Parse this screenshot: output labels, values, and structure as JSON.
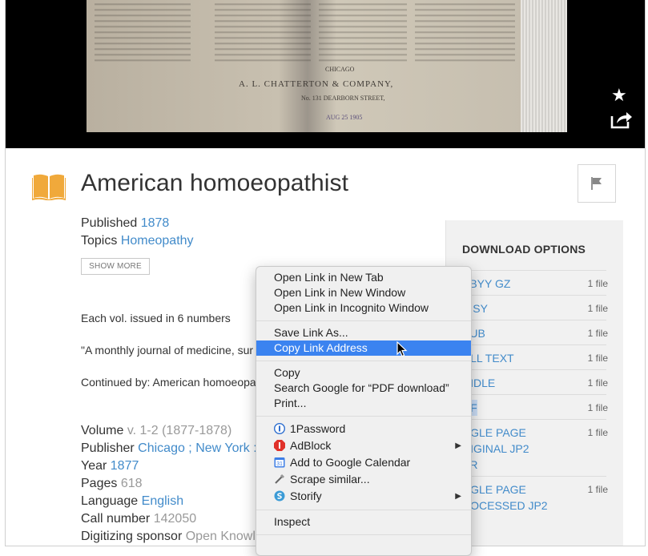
{
  "viewer": {
    "scan_lines": [
      "CHICAGO",
      "A. L. CHATTERTON & COMPANY,",
      "No. 131 DEARBORN STREET,",
      "AUG 25 1905"
    ],
    "star_icon": "star-icon",
    "share_icon": "share-icon"
  },
  "item": {
    "title": "American homoeopathist",
    "published_label": "Published",
    "published_value": "1878",
    "topics_label": "Topics",
    "topics_value": "Homeopathy",
    "show_more": "SHOW MORE",
    "desc1": "Each vol. issued in 6 numbers",
    "desc2": "\"A monthly journal of medicine, sur",
    "desc3": "Continued by: American homoeopa",
    "volume_label": "Volume",
    "volume_value": "v. 1-2 (1877-1878)",
    "publisher_label": "Publisher",
    "publisher_value": "Chicago ; New York : /",
    "year_label": "Year",
    "year_value": "1877",
    "pages_label": "Pages",
    "pages_value": "618",
    "language_label": "Language",
    "language_value": "English",
    "callnumber_label": "Call number",
    "callnumber_value": "142050",
    "sponsor_label": "Digitizing sponsor",
    "sponsor_value": "Open Knowle"
  },
  "download": {
    "title": "DOWNLOAD OPTIONS",
    "rows": [
      {
        "name": "BBYY GZ",
        "count": "1 file"
      },
      {
        "name": "AISY",
        "count": "1 file"
      },
      {
        "name": "PUB",
        "count": "1 file"
      },
      {
        "name": "ULL TEXT",
        "count": "1 file"
      },
      {
        "name": "INDLE",
        "count": "1 file"
      },
      {
        "name": "DF",
        "count": "1 file"
      },
      {
        "name": "NGLE PAGE\nRIGINAL JP2\nAR",
        "count": "1 file"
      },
      {
        "name": "NGLE PAGE\nROCESSED JP2\nP",
        "count": "1 file"
      }
    ]
  },
  "context_menu": {
    "open_new_tab": "Open Link in New Tab",
    "open_new_window": "Open Link in New Window",
    "open_incognito": "Open Link in Incognito Window",
    "save_link": "Save Link As...",
    "copy_link": "Copy Link Address",
    "copy": "Copy",
    "search_google": "Search Google for “PDF download”",
    "print": "Print...",
    "onepassword": "1Password",
    "adblock": "AdBlock",
    "google_calendar": "Add to Google Calendar",
    "scrape": "Scrape similar...",
    "storify": "Storify",
    "inspect": "Inspect"
  },
  "colors": {
    "link": "#428bca",
    "menu_highlight": "#3b83f0",
    "book_icon": "#f0a93b"
  }
}
